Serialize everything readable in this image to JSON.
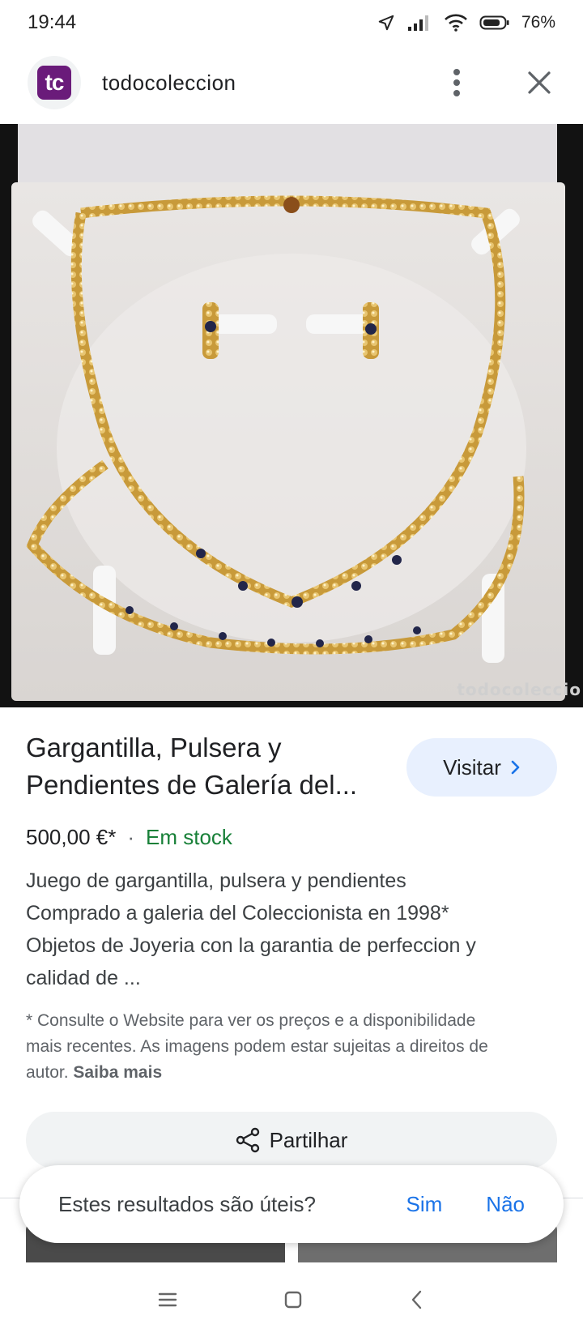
{
  "status_bar": {
    "time": "19:44",
    "battery": "76%",
    "icons": [
      "location-arrow-icon",
      "signal-icon",
      "wifi-icon",
      "battery-icon"
    ]
  },
  "site": {
    "logo_text": "tc",
    "name": "todocoleccion",
    "brand_color": "#6a1b7a",
    "menu_icon": "more-vert-icon",
    "close_icon": "close-icon"
  },
  "image": {
    "watermark": "todocoleccio",
    "alt": "Gargantilla, Pulsera y Pendientes de Galería del Coleccionista"
  },
  "product": {
    "title_line1": "Gargantilla, Pulsera y",
    "title_line2": "Pendientes de Galería del...",
    "visit_label": "Visitar",
    "price": "500,00 €*",
    "separator": "·",
    "stock": "Em stock",
    "description": [
      "Juego de gargantilla, pulsera y pendientes",
      "Comprado a galeria del Coleccionista en 1998*",
      "Objetos de Joyeria con la garantia de perfeccion y",
      "calidad de ..."
    ],
    "disclaimer_lines": [
      "* Consulte o Website para ver os preços e a disponibilidade",
      "mais recentes. As imagens podem estar sujeitas a direitos de",
      "autor. "
    ],
    "learn_more": "Saiba mais"
  },
  "share": {
    "label": "Partilhar",
    "icon": "share-icon"
  },
  "feedback": {
    "question": "Estes resultados são úteis?",
    "yes": "Sim",
    "no": "Não"
  },
  "nav": {
    "icons": [
      "menu-icon",
      "home-square-icon",
      "back-icon"
    ]
  },
  "colors": {
    "accent": "#1a73e8",
    "stock_green": "#188038",
    "visit_bg": "#e8f0fe"
  }
}
